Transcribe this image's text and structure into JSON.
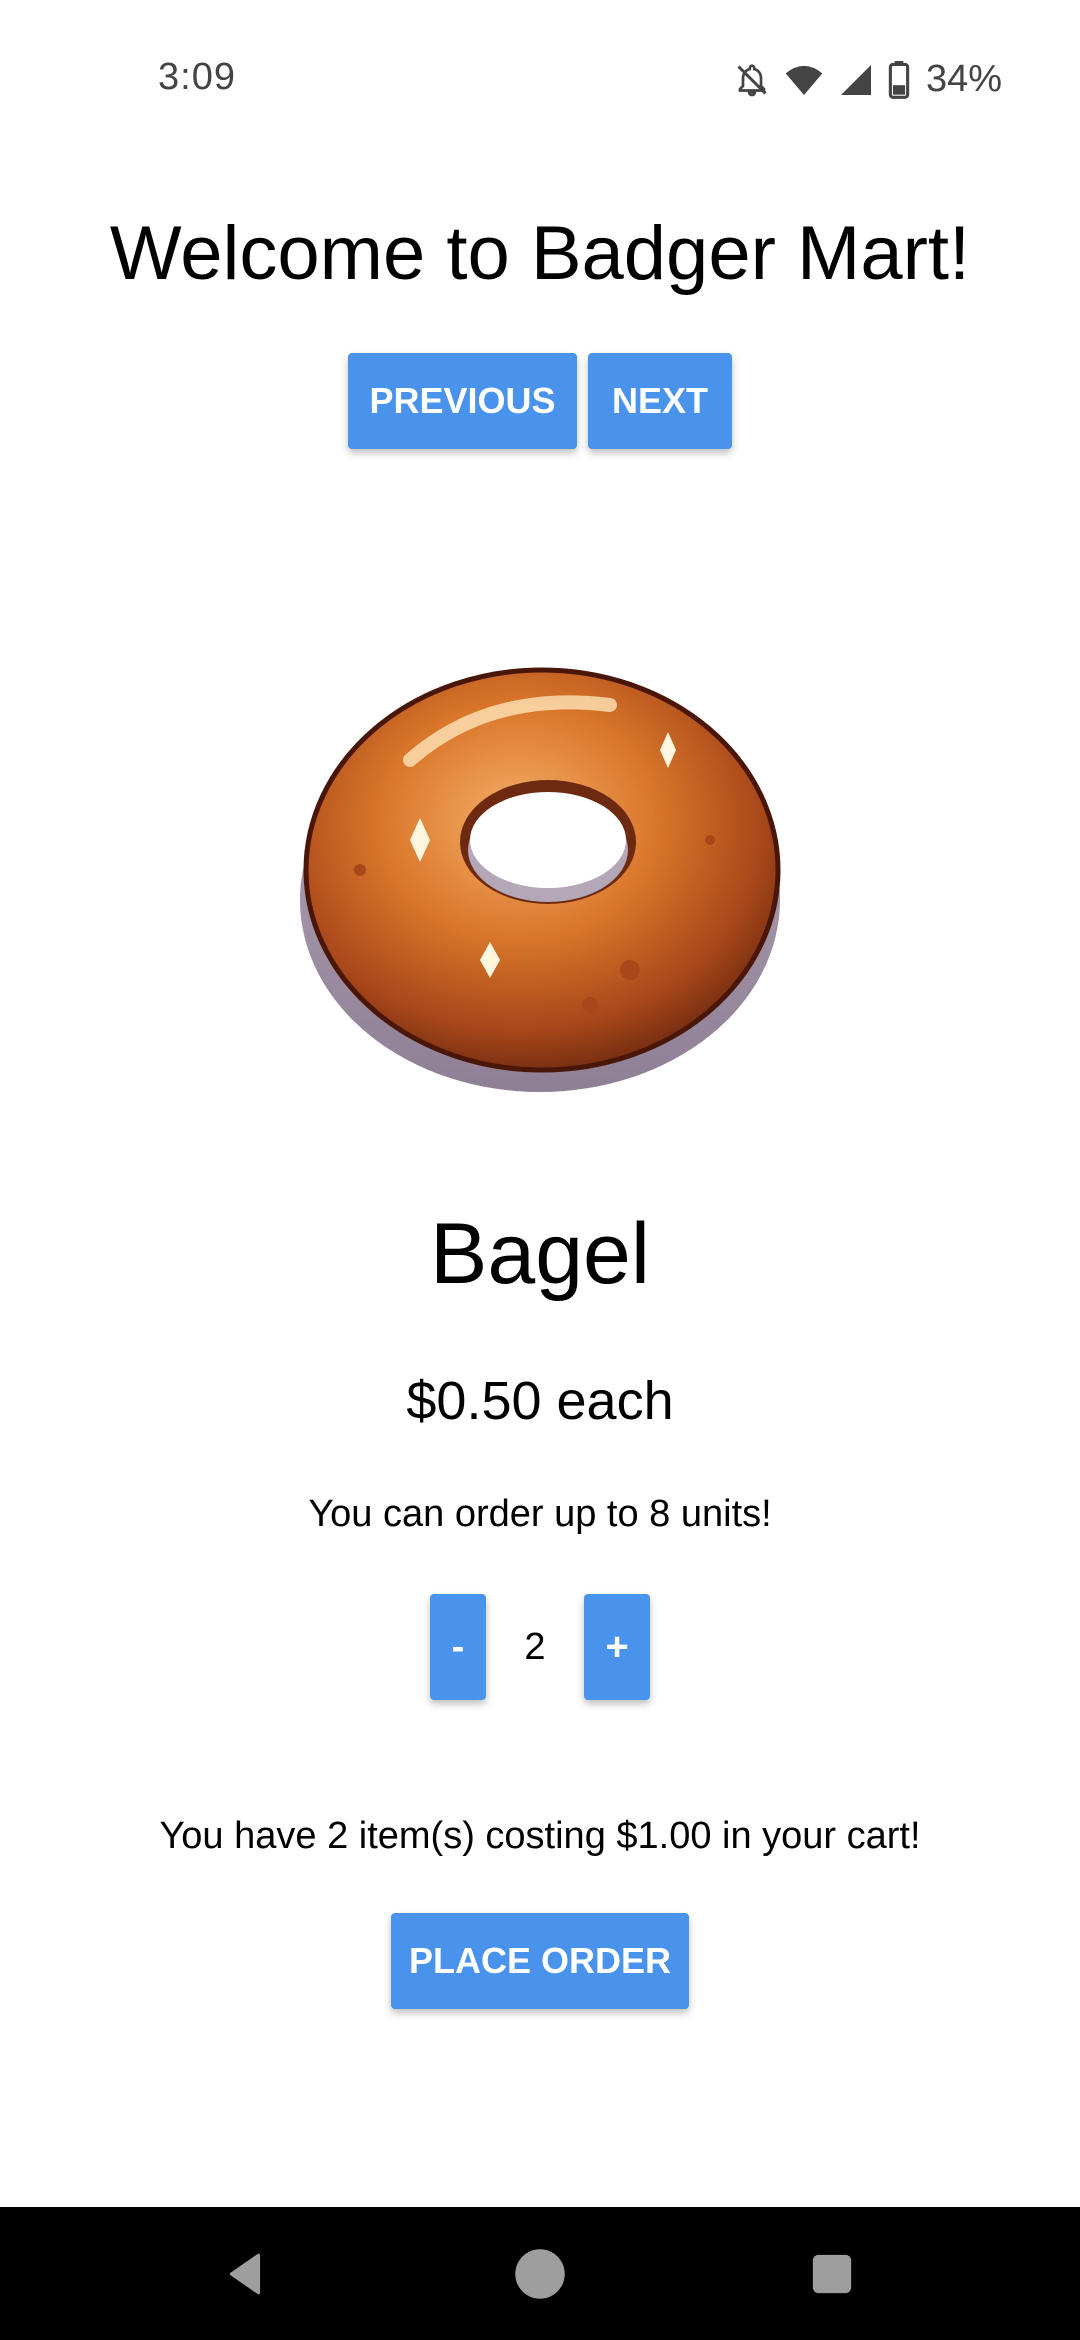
{
  "status_bar": {
    "time": "3:09",
    "battery_percent": "34%",
    "icons": [
      "notifications-off-icon",
      "wifi-icon",
      "signal-icon",
      "battery-icon"
    ]
  },
  "header": {
    "title": "Welcome to Badger Mart!"
  },
  "navigation": {
    "previous_label": "PREVIOUS",
    "next_label": "NEXT"
  },
  "product": {
    "image_name": "bagel-image",
    "name": "Bagel",
    "price_text": "$0.50 each",
    "limit_text": "You can order up to 8 units!"
  },
  "stepper": {
    "minus_label": "-",
    "quantity": "2",
    "plus_label": "+"
  },
  "cart": {
    "summary": "You have 2 item(s) costing $1.00 in your cart!",
    "place_order_label": "PLACE ORDER"
  },
  "system_nav": {
    "icons": [
      "back-icon",
      "home-icon",
      "recents-icon"
    ]
  },
  "colors": {
    "accent": "#4a93ed",
    "background": "#ffffff",
    "nav_bar": "#000000"
  }
}
